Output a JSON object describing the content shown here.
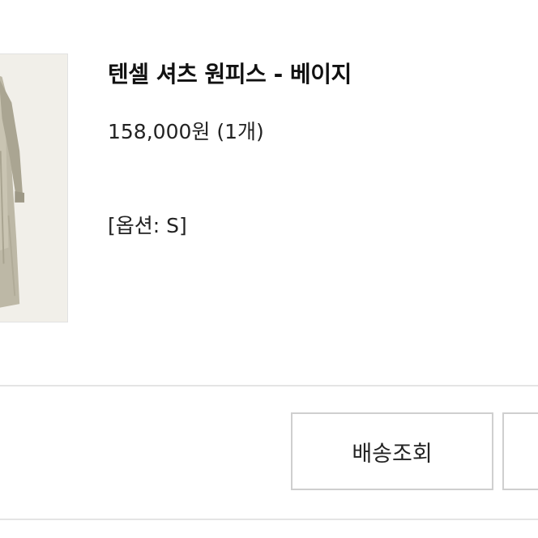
{
  "product": {
    "title": "텐셀 셔츠 원피스 - 베이지",
    "price": "158,000원 (1개)",
    "option": "[옵션: S]"
  },
  "actions": {
    "track_label": "배송조회",
    "second_label": ""
  }
}
